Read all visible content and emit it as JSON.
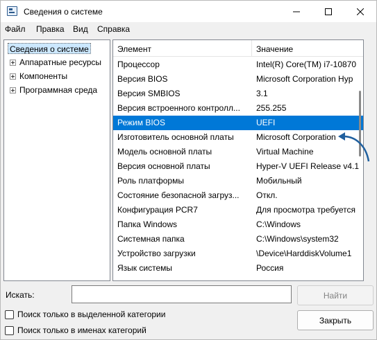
{
  "window": {
    "title": "Сведения о системе"
  },
  "menu": [
    "Файл",
    "Правка",
    "Вид",
    "Справка"
  ],
  "tree": {
    "root": "Сведения о системе",
    "children": [
      "Аппаратные ресурсы",
      "Компоненты",
      "Программная среда"
    ]
  },
  "list": {
    "columns": [
      "Элемент",
      "Значение"
    ],
    "rows": [
      [
        "Процессор",
        "Intel(R) Core(TM) i7-10870"
      ],
      [
        "Версия BIOS",
        "Microsoft Corporation Hyp"
      ],
      [
        "Версия SMBIOS",
        "3.1"
      ],
      [
        "Версия встроенного контролл...",
        "255.255"
      ],
      [
        "Режим BIOS",
        "UEFI"
      ],
      [
        "Изготовитель основной платы",
        "Microsoft Corporation"
      ],
      [
        "Модель основной платы",
        "Virtual Machine"
      ],
      [
        "Версия основной платы",
        "Hyper-V UEFI Release v4.1"
      ],
      [
        "Роль платформы",
        "Мобильный"
      ],
      [
        "Состояние безопасной загруз...",
        "Откл."
      ],
      [
        "Конфигурация PCR7",
        "Для просмотра требуется"
      ],
      [
        "Папка Windows",
        "C:\\Windows"
      ],
      [
        "Системная папка",
        "C:\\Windows\\system32"
      ],
      [
        "Устройство загрузки",
        "\\Device\\HarddiskVolume1"
      ],
      [
        "Язык системы",
        "Россия"
      ]
    ],
    "selected_index": 4
  },
  "search": {
    "label": "Искать:",
    "value": "",
    "find_button": "Найти",
    "close_button": "Закрыть",
    "option_selected_category": "Поиск только в выделенной категории",
    "option_category_names": "Поиск только в именах категорий"
  },
  "colors": {
    "selection": "#0078d7",
    "annotation_arrow": "#1f5f9e"
  }
}
